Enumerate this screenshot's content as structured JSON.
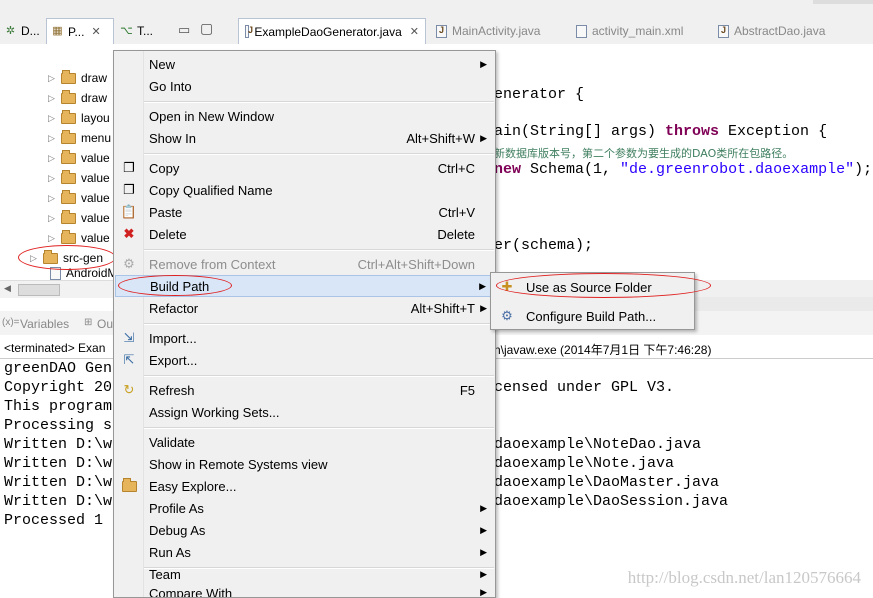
{
  "left_tabs": [
    {
      "label": "D...",
      "icon": "debug-icon"
    },
    {
      "label": "P...",
      "icon": "package-explorer-icon",
      "close": "✕"
    },
    {
      "label": "T...",
      "icon": "type-hierarchy-icon"
    }
  ],
  "view_controls": {
    "minimize": "▭",
    "maximize": "▢"
  },
  "editor_tabs": [
    {
      "label": "ExampleDaoGenerator.java",
      "active": true,
      "close": "✕"
    },
    {
      "label": "MainActivity.java"
    },
    {
      "label": "activity_main.xml"
    },
    {
      "label": "AbstractDao.java"
    }
  ],
  "tree": {
    "items": [
      "draw",
      "draw",
      "layou",
      "menu",
      "value",
      "value",
      "value",
      "value",
      "value"
    ],
    "selected": "src-gen",
    "partial": "AndroidM"
  },
  "code": {
    "line1": "enerator {",
    "line2_a": "ain(String[] args) ",
    "line2_kw": "throws",
    "line2_b": " Exception {",
    "comment": "新数据库版本号，第二个参数为要生成的DAO类所在包路径。",
    "line4_kw": "new",
    "line4_a": " Schema(1, ",
    "line4_str": "\"de.greenrobot.daoexample\"",
    "line4_b": ");",
    "line5": "er(schema);"
  },
  "console": {
    "tab_variables": "Variables",
    "tab_outline": "Ou",
    "terminated_left": "<terminated> Exan",
    "terminated_right": "n\\javaw.exe (2014年7月1日 下午7:46:28)",
    "left_lines": [
      "greenDAO Gen",
      "Copyright 20",
      "This program",
      "Processing s",
      "Written D:\\w",
      "Written D:\\w",
      "Written D:\\w",
      "Written D:\\w",
      "Processed 1"
    ],
    "right_lines": [
      "",
      "censed under GPL V3.",
      "",
      "",
      "daoexample\\NoteDao.java",
      "daoexample\\Note.java",
      "daoexample\\DaoMaster.java",
      "daoexample\\DaoSession.java",
      ""
    ]
  },
  "context_menu": {
    "items": [
      {
        "label": "New",
        "submenu": true
      },
      {
        "label": "Go Into"
      },
      {
        "label": "Open in New Window"
      },
      {
        "label": "Show In",
        "shortcut": "Alt+Shift+W",
        "submenu": true
      },
      {
        "label": "Copy",
        "shortcut": "Ctrl+C",
        "icon": "copy-icon"
      },
      {
        "label": "Copy Qualified Name",
        "icon": "copy-qualified-icon"
      },
      {
        "label": "Paste",
        "shortcut": "Ctrl+V",
        "icon": "paste-icon"
      },
      {
        "label": "Delete",
        "shortcut": "Delete",
        "icon": "delete-icon"
      },
      {
        "label": "Remove from Context",
        "shortcut": "Ctrl+Alt+Shift+Down",
        "disabled": true,
        "icon": "remove-context-icon"
      },
      {
        "label": "Build Path",
        "submenu": true,
        "selected": true
      },
      {
        "label": "Refactor",
        "shortcut": "Alt+Shift+T",
        "submenu": true
      },
      {
        "label": "Import...",
        "icon": "import-icon"
      },
      {
        "label": "Export...",
        "icon": "export-icon"
      },
      {
        "label": "Refresh",
        "shortcut": "F5",
        "icon": "refresh-icon"
      },
      {
        "label": "Assign Working Sets..."
      },
      {
        "label": "Validate"
      },
      {
        "label": "Show in Remote Systems view"
      },
      {
        "label": "Easy Explore...",
        "icon": "easy-explore-icon"
      },
      {
        "label": "Profile As",
        "submenu": true
      },
      {
        "label": "Debug As",
        "submenu": true
      },
      {
        "label": "Run As",
        "submenu": true
      },
      {
        "label": "Team",
        "submenu": true
      },
      {
        "label": "Compare With",
        "submenu": true
      }
    ],
    "submenu_arrow": "▶"
  },
  "build_path_submenu": {
    "items": [
      {
        "label": "Use as Source Folder",
        "icon": "source-folder-icon"
      },
      {
        "label": "Configure Build Path...",
        "icon": "configure-build-path-icon"
      }
    ]
  },
  "watermark": "http://blog.csdn.net/lan120576664",
  "colors": {
    "keyword": "#7f0055",
    "string": "#2a00ff",
    "comment": "#3f7f5f",
    "highlight_ellipse": "#e02020",
    "menu_selection": "#d8e6f7"
  }
}
